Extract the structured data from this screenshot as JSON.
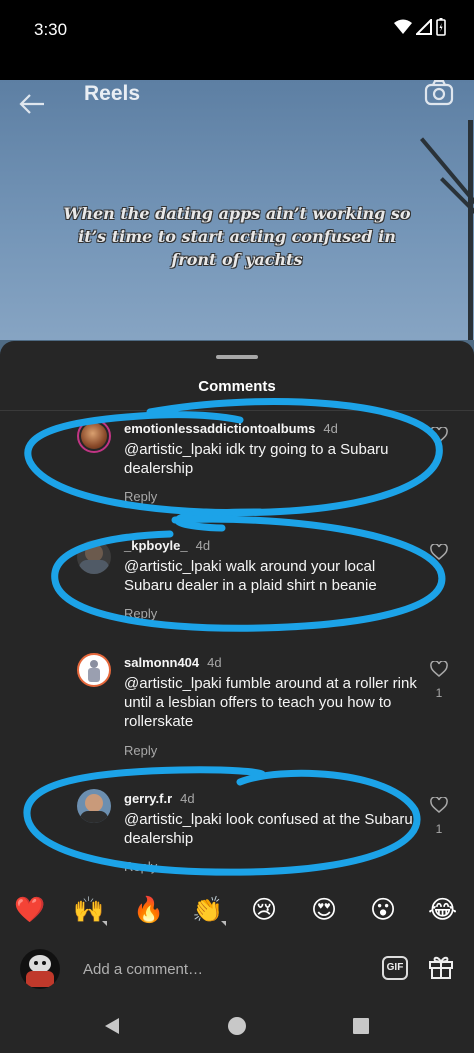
{
  "status_bar": {
    "time": "3:30"
  },
  "reel": {
    "title": "Reels",
    "caption": "When the dating apps ain’t working so it’s time to start acting confused in front of yachts"
  },
  "comments_sheet": {
    "title": "Comments",
    "comments": [
      {
        "username": "emotionlessaddictiontoalbums",
        "age": "4d",
        "text": "@artistic_lpaki idk try going to a Subaru dealership",
        "reply": "Reply",
        "likes": ""
      },
      {
        "username": "_kpboyle_",
        "age": "4d",
        "text": "@artistic_lpaki walk around your local Subaru dealer in a plaid shirt n beanie",
        "reply": "Reply",
        "likes": ""
      },
      {
        "username": "salmonn404",
        "age": "4d",
        "text": "@artistic_lpaki fumble around at a roller rink until a lesbian offers to teach you how to rollerskate",
        "reply": "Reply",
        "likes": "1"
      },
      {
        "username": "gerry.f.r",
        "age": "4d",
        "text": "@artistic_lpaki look confused at the Subaru dealership",
        "reply": "Reply",
        "likes": "1"
      }
    ]
  },
  "quick_reactions": [
    "❤️",
    "🙌",
    "🔥",
    "👏",
    "😢",
    "😍",
    "😮",
    "😂"
  ],
  "composer": {
    "placeholder": "Add a comment…",
    "gif_label": "GIF"
  },
  "colors": {
    "sheet_bg": "#262626",
    "annotation": "#1ca3e8",
    "like_gray": "#a8a8a8"
  },
  "icons": [
    "back-arrow-icon",
    "camera-icon",
    "heart-outline-icon",
    "gift-icon",
    "nav-back-icon",
    "nav-home-icon",
    "nav-recents-icon"
  ]
}
